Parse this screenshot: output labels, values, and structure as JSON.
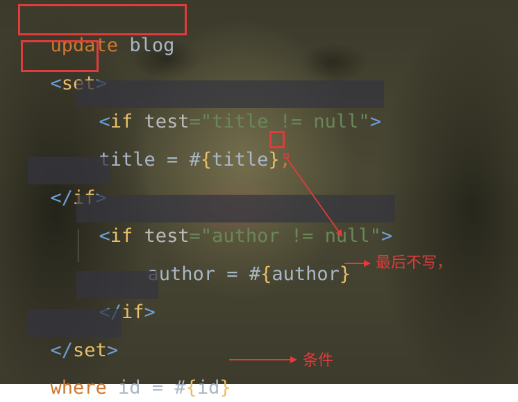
{
  "code": {
    "line1": {
      "kw": "update",
      "rest": " blog"
    },
    "line2": {
      "open": "<",
      "tag": "set",
      "close": ">"
    },
    "line3": {
      "open": "<",
      "tag": "if",
      "attr": " test",
      "eq": "=",
      "str": "\"title != null\"",
      "close": ">"
    },
    "line4": {
      "text": "title = #",
      "lb": "{",
      "field": "title",
      "rb": "}",
      "comma": ","
    },
    "line5": {
      "open": "</",
      "tag": "if",
      "close": ">"
    },
    "line6": {
      "open": "<",
      "tag": "if",
      "attr": " test",
      "eq": "=",
      "str": "\"author != null\"",
      "close": ">"
    },
    "line7": {
      "text": "author = #",
      "lb": "{",
      "field": "author",
      "rb": "}"
    },
    "line8": {
      "open": "</",
      "tag": "if",
      "close": ">"
    },
    "line9": {
      "open": "</",
      "tag": "set",
      "close": ">"
    },
    "line10": {
      "kw": "where",
      "rest": " id = #",
      "lb": "{",
      "field": "id",
      "rb": "}"
    }
  },
  "annotations": {
    "last_no_comma": "最后不写，",
    "condition": "条件"
  },
  "colors": {
    "keyword": "#cc7832",
    "tag": "#e8bf6a",
    "string": "#6a8759",
    "annotation_red": "#e23b3b"
  }
}
